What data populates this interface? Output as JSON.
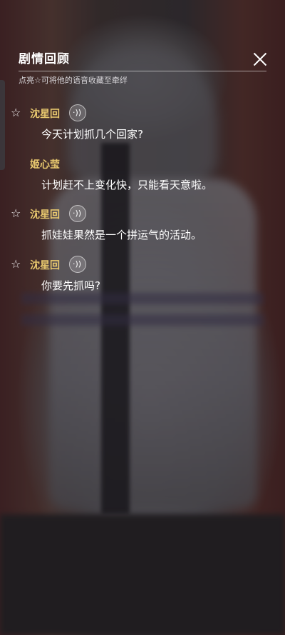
{
  "panel": {
    "title": "剧情回顾",
    "hint": "点亮☆可将他的语音收藏至牵绊"
  },
  "icons": {
    "star": "☆",
    "voice": "·))"
  },
  "entries": [
    {
      "speaker": "沈星回",
      "text": "今天计划抓几个回家?",
      "has_voice": true,
      "has_star": true
    },
    {
      "speaker": "姬心莹",
      "text": "计划赶不上变化快，只能看天意啦。",
      "has_voice": false,
      "has_star": false
    },
    {
      "speaker": "沈星回",
      "text": "抓娃娃果然是一个拼运气的活动。",
      "has_voice": true,
      "has_star": true
    },
    {
      "speaker": "沈星回",
      "text": "你要先抓吗?",
      "has_voice": true,
      "has_star": true
    }
  ],
  "colors": {
    "speaker": "#e7c76e",
    "text": "#ffffff"
  }
}
